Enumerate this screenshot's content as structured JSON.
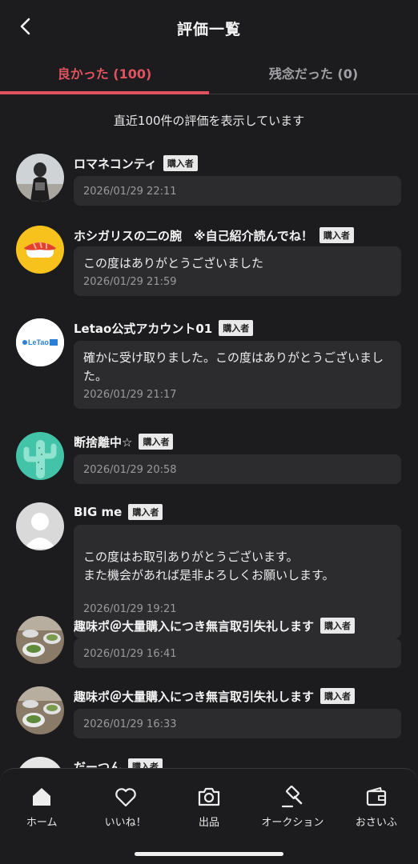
{
  "header": {
    "title": "評価一覧",
    "back_icon": "chevron-left-icon"
  },
  "tabs": [
    {
      "label": "良かった (100)",
      "active": true
    },
    {
      "label": "残念だった (0)",
      "active": false
    }
  ],
  "notice": "直近100件の評価を表示しています",
  "reviews": [
    {
      "name": "ロマネコンティ",
      "badge": "購入者",
      "comment": "",
      "date": "2026/01/29 22:11",
      "avatar": "photo-avatar"
    },
    {
      "name": "ホシガリスの二の腕　※自己紹介読んでね！",
      "badge": "購入者",
      "comment": "この度はありがとうございました",
      "date": "2026/01/29 21:59",
      "avatar": "sushi-avatar"
    },
    {
      "name": "Letao公式アカウント01",
      "badge": "購入者",
      "comment": "確かに受け取りました。この度はありがとうございました。",
      "date": "2026/01/29 21:17",
      "avatar": "letao-logo-avatar",
      "avatar_text": "LeTao"
    },
    {
      "name": "断捨離中☆",
      "badge": "購入者",
      "comment": "",
      "date": "2026/01/29 20:58",
      "avatar": "cactus-avatar"
    },
    {
      "name": "BIG me",
      "badge": "購入者",
      "comment": "この度はお取引ありがとうございます。\nまた機会があれば是非よろしくお願いします。",
      "date": "2026/01/29 19:21",
      "avatar": "default-user-avatar"
    },
    {
      "name": "趣味ポ＠大量購入につき無言取引失礼します",
      "badge": "購入者",
      "comment": "",
      "date": "2026/01/29 16:41",
      "avatar": "food-photo-avatar"
    },
    {
      "name": "趣味ポ＠大量購入につき無言取引失礼します",
      "badge": "購入者",
      "comment": "",
      "date": "2026/01/29 16:33",
      "avatar": "food-photo-avatar"
    },
    {
      "name": "だーつん",
      "badge": "購入者",
      "comment": "",
      "date": "",
      "avatar": "partial-avatar"
    }
  ],
  "bottom_nav": [
    {
      "label": "ホーム",
      "icon": "home-icon"
    },
    {
      "label": "いいね！",
      "icon": "heart-icon"
    },
    {
      "label": "出品",
      "icon": "camera-icon"
    },
    {
      "label": "オークション",
      "icon": "gavel-icon"
    },
    {
      "label": "おさいふ",
      "icon": "wallet-icon"
    }
  ],
  "colors": {
    "accent": "#e05260",
    "background": "#1c1c1e",
    "bubble": "#2c2c2e"
  }
}
